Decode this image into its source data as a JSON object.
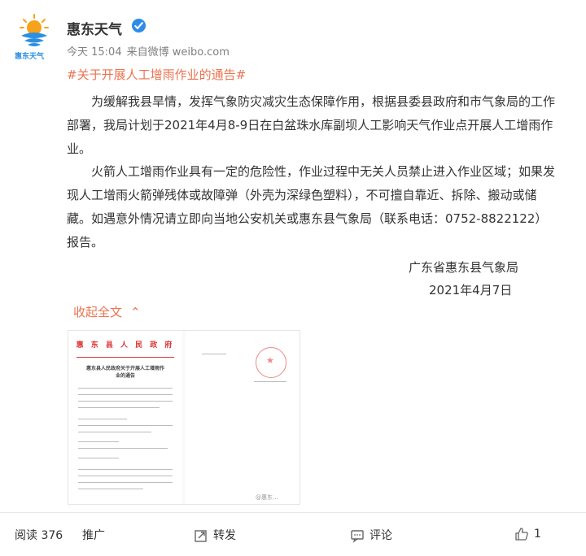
{
  "post": {
    "author": "惠东天气",
    "avatar_caption": "惠东天气",
    "meta": {
      "time": "今天 15:04",
      "source_prefix": "来自",
      "source": "微博 weibo.com"
    },
    "topic": "#关于开展人工增雨作业的通告#",
    "paragraphs": [
      "为缓解我县旱情，发挥气象防灾减灾生态保障作用，根据县委县政府和市气象局的工作部署，我局计划于2021年4月8-9日在白盆珠水库副坝人工影响天气作业点开展人工增雨作业。",
      "火箭人工增雨作业具有一定的危险性，作业过程中无关人员禁止进入作业区域；如果发现人工增雨火箭弹残体或故障弹（外壳为深绿色塑料），不可擅自靠近、拆除、搬动或储藏。如遇意外情况请立即向当地公安机关或惠东县气象局（联系电话：0752-8822122）报告。"
    ],
    "signature": "广东省惠东县气象局",
    "date": "2021年4月7日",
    "collapse_label": "收起全文",
    "thumbnail": {
      "header": "惠 东 县 人 民 政 府",
      "title": "惠东县人民政府关于开展人工增雨作业的通告",
      "watermark": "@惠东..."
    }
  },
  "actions": {
    "read_count": "阅读 376",
    "promote": "推广",
    "repost": "转发",
    "comment": "评论",
    "like_count": "1"
  },
  "colors": {
    "accent": "#eb7350",
    "avatar_blue": "#2c8fe0",
    "avatar_orange": "#f7a21b",
    "verified": "#2e8ce8"
  }
}
